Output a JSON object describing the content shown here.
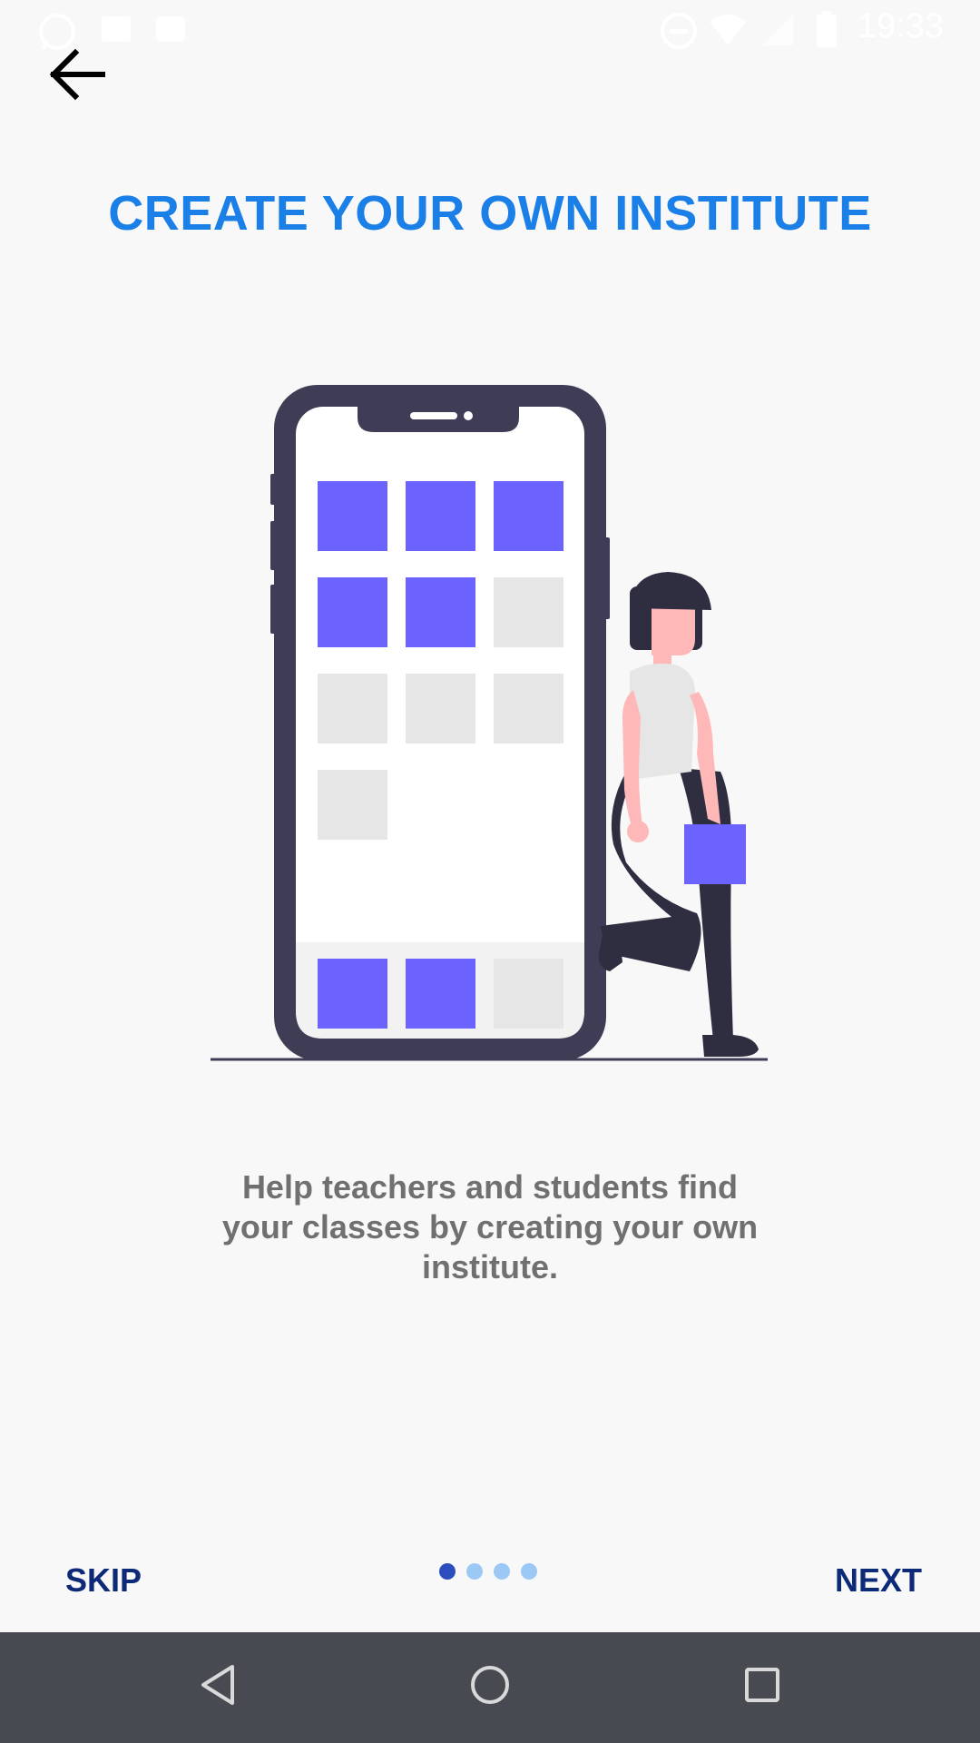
{
  "status_bar": {
    "time": "19:33",
    "left_icons": [
      "whatsapp-icon",
      "image-icon",
      "message-icon"
    ],
    "right_icons": [
      "dnd-icon",
      "wifi-icon",
      "signal-icon",
      "battery-icon"
    ]
  },
  "header": {
    "back_icon": "arrow-left-icon",
    "title": "CREATE YOUR OWN INSTITUTE"
  },
  "illustration": {
    "accent_color": "#6c63ff",
    "phone_frame_color": "#3f3d56",
    "tile_inactive_color": "#e6e6e6",
    "grid_tiles": [
      [
        "on",
        "on",
        "on"
      ],
      [
        "on",
        "on",
        "off"
      ],
      [
        "off",
        "off",
        "off"
      ],
      [
        "off",
        "",
        ""
      ]
    ],
    "dock_tiles": [
      "on",
      "on",
      "off"
    ]
  },
  "description": "Help teachers and students find your classes by creating your own institute.",
  "footer": {
    "skip_label": "SKIP",
    "next_label": "NEXT",
    "page_count": 4,
    "current_page": 1
  },
  "nav_bar": {
    "icons": [
      "back-triangle-icon",
      "home-circle-icon",
      "recents-square-icon"
    ]
  },
  "colors": {
    "title": "#1a7fe6",
    "button_text": "#0d2a78",
    "background": "#f8f8f9",
    "nav_bar": "#474b51",
    "dot_active": "#2b4dbd",
    "dot_inactive": "#9cc8f5"
  }
}
